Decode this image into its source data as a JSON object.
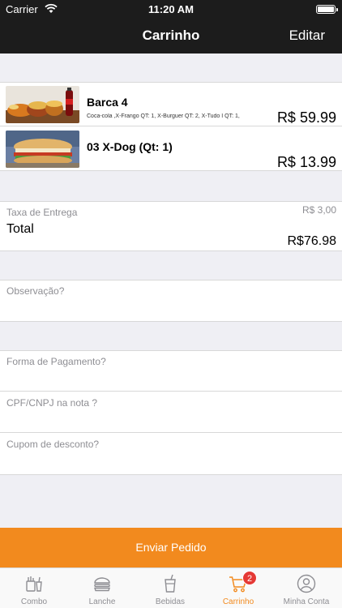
{
  "status_bar": {
    "carrier": "Carrier",
    "time": "11:20 AM"
  },
  "nav": {
    "title": "Carrinho",
    "edit_label": "Editar"
  },
  "cart": {
    "items": [
      {
        "name": "Barca 4",
        "description": "Coca-cola ,X-Frango QT: 1, X-Burguer QT: 2, X-Tudo I QT: 1,",
        "price": "R$ 59.99"
      },
      {
        "name": "03  X-Dog (Qt: 1)",
        "description": "",
        "price": "R$ 13.99"
      }
    ]
  },
  "totals": {
    "delivery_fee_label": "Taxa de Entrega",
    "delivery_fee_value": "R$ 3,00",
    "total_label": "Total",
    "total_value": "R$76.98"
  },
  "fields": {
    "observation_placeholder": "Observação?",
    "payment_placeholder": "Forma de Pagamento?",
    "cpf_placeholder": "CPF/CNPJ na nota ?",
    "coupon_placeholder": "Cupom de desconto?"
  },
  "submit_label": "Enviar Pedido",
  "tabs": [
    {
      "label": "Combo",
      "icon": "combo-icon"
    },
    {
      "label": "Lanche",
      "icon": "burger-icon"
    },
    {
      "label": "Bebidas",
      "icon": "drink-icon"
    },
    {
      "label": "Carrinho",
      "icon": "cart-icon",
      "badge": "2",
      "active": true
    },
    {
      "label": "Minha Conta",
      "icon": "account-icon"
    }
  ],
  "colors": {
    "accent": "#f28a1e",
    "badge": "#e53935",
    "bar": "#1c1c1c"
  }
}
